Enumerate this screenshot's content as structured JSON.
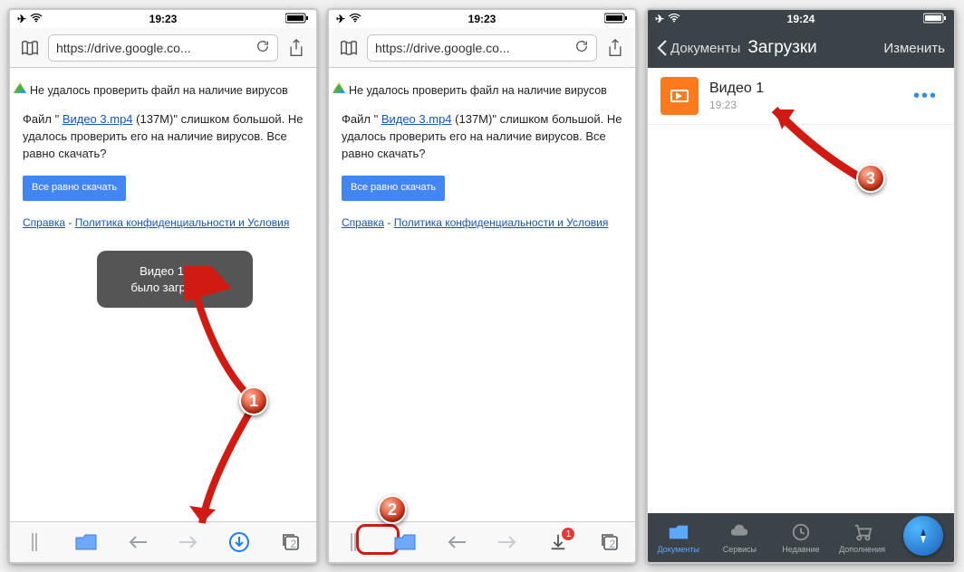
{
  "phone1": {
    "time": "19:23",
    "url": "https://drive.google.co...",
    "page_heading": "Не удалось проверить файл на наличие вирусов",
    "body_prefix": "Файл \" ",
    "body_filelink": "Видео 3.mp4",
    "body_suffix": " (137M)\" слишком большой. Не удалось проверить его на наличие вирусов. Все равно скачать?",
    "button": "Все равно скачать",
    "footer_help": "Справка",
    "footer_policy": "Политика конфиденциальности и Условия ",
    "toast_line1": "Видео 1.mp4",
    "toast_line2": "было загружено",
    "tabs_count": "2",
    "marker": "1"
  },
  "phone2": {
    "time": "19:23",
    "url": "https://drive.google.co...",
    "tabs_count": "2",
    "dl_badge": "1",
    "marker": "2"
  },
  "phone3": {
    "time": "19:24",
    "back_label": "Документы",
    "title": "Загрузки",
    "edit": "Изменить",
    "file_name": "Видео 1",
    "file_time": "19:23",
    "tab_docs": "Документы",
    "tab_services": "Сервисы",
    "tab_recent": "Недавние",
    "tab_addons": "Дополнения",
    "marker": "3"
  }
}
